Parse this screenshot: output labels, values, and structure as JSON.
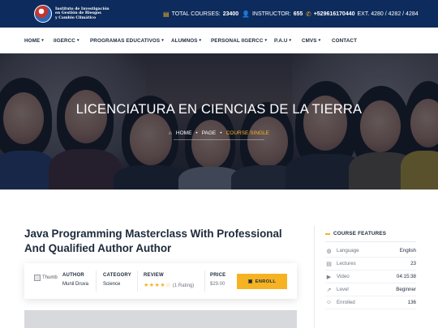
{
  "logo": {
    "text_line1": "Instituto de Investigación",
    "text_line2": "en Gestión de Riesgos",
    "text_line3": "y Cambio Climático"
  },
  "topbar": {
    "total_courses_label": "TOTAL COURSES:",
    "total_courses_value": "23400",
    "instructor_label": "INSTRUCTOR:",
    "instructor_value": "655",
    "phone": "+529616170440",
    "phone_ext": "EXT. 4280 / 4282 / 4284"
  },
  "nav": {
    "items": [
      {
        "label": "HOME"
      },
      {
        "label": "IIGERCC"
      },
      {
        "label": "PROGRAMAS EDUCATIVOS"
      },
      {
        "label": "ALUMNOS"
      },
      {
        "label": "PERSONAL IIGERCC"
      },
      {
        "label": "P.A.U"
      },
      {
        "label": "CMVS"
      },
      {
        "label": "CONTACT"
      }
    ]
  },
  "hero": {
    "title": "LICENCIATURA EN CIENCIAS DE LA TIERRA",
    "breadcrumb": {
      "home": "HOME",
      "page": "PAGE",
      "current": "COURSE SINGLE",
      "separator": "•"
    }
  },
  "course": {
    "title": "Java Programming Masterclass With Professional And Qualified Author Author",
    "thumb_alt": "Thumb",
    "author_label": "AUTHOR",
    "author_value": "Munil Druva",
    "category_label": "CATEGORY",
    "category_value": "Science",
    "review_label": "REVIEW",
    "review_stars": "★★★★☆",
    "review_rating": 4.5,
    "review_count": "(1 Rating)",
    "price_label": "PRICE",
    "price_value": "$29.00",
    "enroll_label": "ENROLL"
  },
  "sidebar": {
    "heading": "COURSE FEATURES",
    "features": [
      {
        "icon": "globe-icon",
        "name": "Language",
        "value": "English"
      },
      {
        "icon": "lectures-icon",
        "name": "Lectures",
        "value": "23"
      },
      {
        "icon": "video-icon",
        "name": "Video",
        "value": "04:15:38"
      },
      {
        "icon": "level-icon",
        "name": "Level",
        "value": "Beginner"
      },
      {
        "icon": "enrolled-icon",
        "name": "Enrolled",
        "value": "136"
      }
    ]
  },
  "colors": {
    "topbar_bg": "#0d2b5c",
    "accent": "#f5b323",
    "text_dark": "#1d2a3b"
  }
}
